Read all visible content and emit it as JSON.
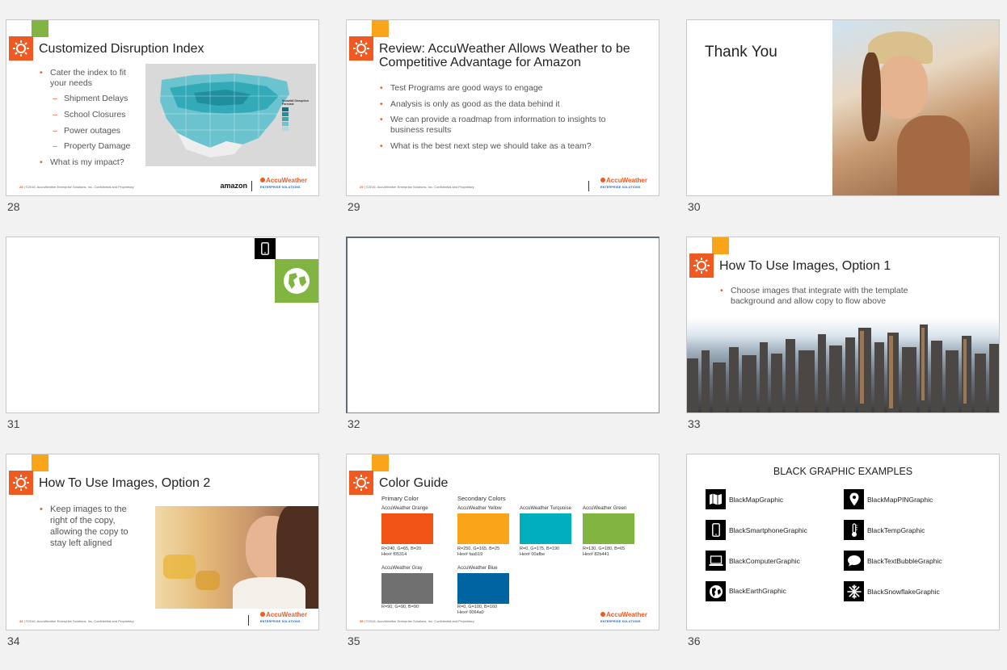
{
  "slides": [
    {
      "number": "28",
      "title": "Customized Disruption Index",
      "bullets": [
        "Cater the index to fit your needs",
        "What is my impact?"
      ],
      "sub_bullets": [
        "Shipment Delays",
        "School Closures",
        "Power outages",
        "Property Damage"
      ],
      "map_legend": "Snowfall Disruption Forecast",
      "footer_num": "28",
      "footer_text": "©2016, AccuWeather Enterprise Solutions, Inc. Confidential and Proprietary",
      "partner_logo": "amazon",
      "brand_logo": "AccuWeather",
      "brand_sub": "ENTERPRISE SOLUTIONS"
    },
    {
      "number": "29",
      "title": "Review: AccuWeather Allows Weather to be Competitive Advantage for Amazon",
      "bullets": [
        "Test Programs are good ways to engage",
        "Analysis is only as good as the data behind it",
        "We can provide a roadmap from information to insights to business results",
        "What is the best next step we should take as a team?"
      ],
      "footer_num": "29",
      "footer_text": "©2016, AccuWeather Enterprise Solutions, Inc. Confidential and Proprietary",
      "brand_logo": "AccuWeather",
      "brand_sub": "ENTERPRISE SOLUTIONS"
    },
    {
      "number": "30",
      "title": "Thank You"
    },
    {
      "number": "31"
    },
    {
      "number": "32"
    },
    {
      "number": "33",
      "title": "How To Use Images, Option 1",
      "bullets": [
        "Choose images that integrate with the template background and allow copy to flow above"
      ]
    },
    {
      "number": "34",
      "title": "How To Use Images, Option 2",
      "bullets": [
        "Keep images to the right of the copy, allowing the copy to stay left aligned"
      ],
      "footer_num": "34",
      "footer_text": "©2016, AccuWeather Enterprise Solutions, Inc. Confidential and Proprietary",
      "brand_logo": "AccuWeather",
      "brand_sub": "ENTERPRISE SOLUTIONS"
    },
    {
      "number": "35",
      "title": "Color Guide",
      "primary_label": "Primary Color",
      "secondary_label": "Secondary Colors",
      "colors": [
        {
          "name": "AccuWeather Orange",
          "rgb": "R=240, G=65, B=20",
          "hex": "Hex# f05314",
          "color": "#f05314"
        },
        {
          "name": "AccuWeather Yellow",
          "rgb": "R=250, G=165, B=25",
          "hex": "Hex# faa519",
          "color": "#faa519"
        },
        {
          "name": "AccuWeather Turquoise",
          "rgb": "R=0, G=175, B=190",
          "hex": "Hex# 00afbe",
          "color": "#00afbe"
        },
        {
          "name": "AccuWeather Green",
          "rgb": "R=130, G=180, B=65",
          "hex": "Hex# 82b441",
          "color": "#82b441"
        },
        {
          "name": "AccuWeather Gray",
          "rgb": "R=90, G=90, B=90",
          "hex": "",
          "color": "#707070"
        },
        {
          "name": "AccuWeather Blue",
          "rgb": "R=0, G=100, B=160",
          "hex": "Hex# 0064a0",
          "color": "#0064a0"
        }
      ],
      "footer_num": "35",
      "footer_text": "©2016, AccuWeather Enterprise Solutions, Inc. Confidential and Proprietary",
      "brand_logo": "AccuWeather",
      "brand_sub": "ENTERPRISE SOLUTIONS"
    },
    {
      "number": "36",
      "title": "BLACK GRAPHIC EXAMPLES",
      "items": [
        {
          "label": "BlackMapGraphic",
          "icon": "map-icon"
        },
        {
          "label": "BlackMapPINGraphic",
          "icon": "map-pin-icon"
        },
        {
          "label": "BlackSmartphoneGraphic",
          "icon": "smartphone-icon"
        },
        {
          "label": "BlackTempGraphic",
          "icon": "thermometer-icon"
        },
        {
          "label": "BlackComputerGraphic",
          "icon": "computer-icon"
        },
        {
          "label": "BlackTextBubbleGraphic",
          "icon": "text-bubble-icon"
        },
        {
          "label": "BlackEarthGraphic",
          "icon": "earth-icon"
        },
        {
          "label": "BlackSnowflakeGraphic",
          "icon": "snowflake-icon"
        }
      ]
    }
  ],
  "colors": {
    "orange": "#f05a22",
    "yellow": "#faa519",
    "green": "#82b441"
  }
}
